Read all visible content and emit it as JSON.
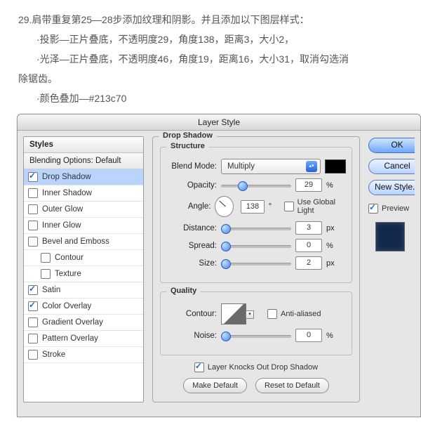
{
  "instructions": {
    "line1": "29.肩带重复第25—28步添加纹理和阴影。并且添加以下图层样式：",
    "sub1": "·投影—正片叠底，不透明度29，角度138，距离3，大小2，",
    "sub2": "·光泽—正片叠底，不透明度46，角度19，距离16，大小31，取消勾选消",
    "sub2b": "除锯齿。",
    "sub3": "·颜色叠加—#213c70"
  },
  "dialog": {
    "title": "Layer Style",
    "styles_header": "Styles",
    "blending_header": "Blending Options: Default",
    "effects": [
      {
        "label": "Drop Shadow",
        "checked": true,
        "selected": true,
        "indent": false
      },
      {
        "label": "Inner Shadow",
        "checked": false,
        "selected": false,
        "indent": false
      },
      {
        "label": "Outer Glow",
        "checked": false,
        "selected": false,
        "indent": false
      },
      {
        "label": "Inner Glow",
        "checked": false,
        "selected": false,
        "indent": false
      },
      {
        "label": "Bevel and Emboss",
        "checked": false,
        "selected": false,
        "indent": false
      },
      {
        "label": "Contour",
        "checked": false,
        "selected": false,
        "indent": true
      },
      {
        "label": "Texture",
        "checked": false,
        "selected": false,
        "indent": true
      },
      {
        "label": "Satin",
        "checked": true,
        "selected": false,
        "indent": false
      },
      {
        "label": "Color Overlay",
        "checked": true,
        "selected": false,
        "indent": false
      },
      {
        "label": "Gradient Overlay",
        "checked": false,
        "selected": false,
        "indent": false
      },
      {
        "label": "Pattern Overlay",
        "checked": false,
        "selected": false,
        "indent": false
      },
      {
        "label": "Stroke",
        "checked": false,
        "selected": false,
        "indent": false
      }
    ],
    "drop_shadow": {
      "group_title": "Drop Shadow",
      "structure_title": "Structure",
      "quality_title": "Quality",
      "blend_mode_label": "Blend Mode:",
      "blend_mode_value": "Multiply",
      "color_swatch": "#000000",
      "opacity_label": "Opacity:",
      "opacity_value": "29",
      "opacity_unit": "%",
      "angle_label": "Angle:",
      "angle_value": "138",
      "angle_unit": "°",
      "use_global_label": "Use Global Light",
      "use_global_checked": false,
      "distance_label": "Distance:",
      "distance_value": "3",
      "distance_unit": "px",
      "spread_label": "Spread:",
      "spread_value": "0",
      "spread_unit": "%",
      "size_label": "Size:",
      "size_value": "2",
      "size_unit": "px",
      "contour_label": "Contour:",
      "anti_aliased_label": "Anti-aliased",
      "anti_aliased_checked": false,
      "noise_label": "Noise:",
      "noise_value": "0",
      "noise_unit": "%",
      "knocks_out_label": "Layer Knocks Out Drop Shadow",
      "knocks_out_checked": true,
      "make_default": "Make Default",
      "reset_default": "Reset to Default"
    },
    "buttons": {
      "ok": "OK",
      "cancel": "Cancel",
      "new_style": "New Style...",
      "preview": "Preview",
      "preview_checked": true,
      "preview_swatch": "#13294b"
    }
  }
}
